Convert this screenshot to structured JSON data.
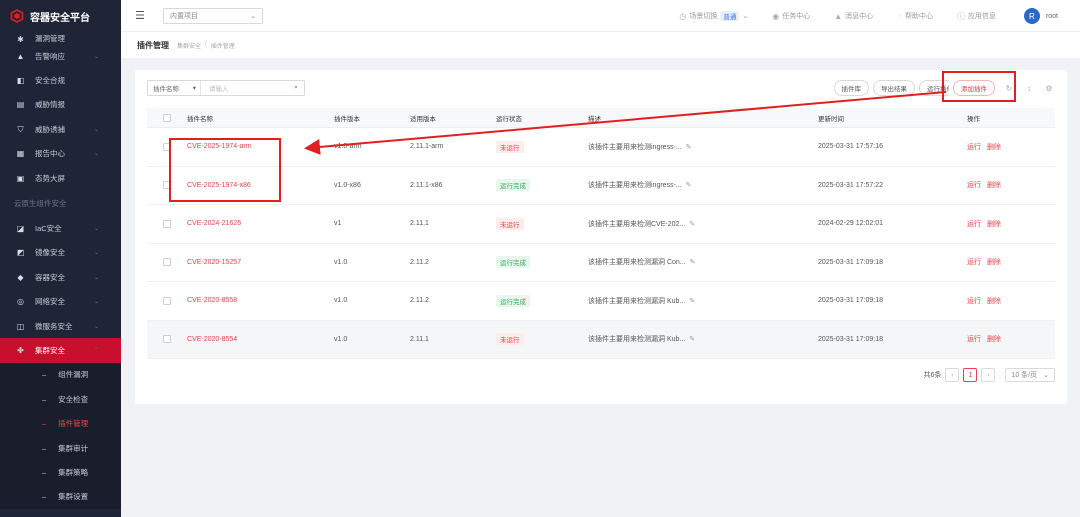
{
  "brand": {
    "title": "容器安全平台"
  },
  "sidebar": {
    "top_clipped": "漏洞管理",
    "items": [
      {
        "label": "告警响应",
        "icon": "bell-icon",
        "glyph": "▲",
        "chev": true
      },
      {
        "label": "安全合规",
        "icon": "clipboard-icon",
        "glyph": "◧",
        "chev": false
      },
      {
        "label": "威胁情报",
        "icon": "database-icon",
        "glyph": "▤",
        "chev": false
      },
      {
        "label": "威胁诱捕",
        "icon": "shield-icon",
        "glyph": "⛉",
        "chev": true
      },
      {
        "label": "报告中心",
        "icon": "report-icon",
        "glyph": "▦",
        "chev": true
      },
      {
        "label": "态势大屏",
        "icon": "screen-icon",
        "glyph": "▣",
        "chev": false
      }
    ],
    "group_title": "云原生组件安全",
    "group_items": [
      {
        "label": "IaC安全",
        "icon": "code-icon",
        "glyph": "◪",
        "chev": true
      },
      {
        "label": "镜像安全",
        "icon": "image-icon",
        "glyph": "◩",
        "chev": true
      },
      {
        "label": "容器安全",
        "icon": "container-icon",
        "glyph": "◆",
        "chev": true
      },
      {
        "label": "网络安全",
        "icon": "network-icon",
        "glyph": "◎",
        "chev": true
      },
      {
        "label": "微服务安全",
        "icon": "microservice-icon",
        "glyph": "◫",
        "chev": true
      },
      {
        "label": "集群安全",
        "icon": "cluster-icon",
        "glyph": "✤",
        "chev": true,
        "active": true
      }
    ],
    "sub_items": [
      {
        "label": "组件漏洞"
      },
      {
        "label": "安全检查"
      },
      {
        "label": "插件管理",
        "active": true
      },
      {
        "label": "集群审计"
      },
      {
        "label": "集群策略"
      },
      {
        "label": "集群设置"
      }
    ]
  },
  "topbar": {
    "project_select": "内置项目",
    "scene_label": "场景切换",
    "scene_badge": "普通",
    "task_center": "任务中心",
    "message_center": "消息中心",
    "help_center": "帮助中心",
    "app_info": "应用信息",
    "avatar_letter": "R",
    "user": "root"
  },
  "breadcrumb": {
    "page_title": "插件管理",
    "crumb_parent": "集群安全",
    "crumb_sep": "/",
    "crumb_current": "插件管理"
  },
  "filter": {
    "field": "插件名称",
    "placeholder": "请输入"
  },
  "toolbar": {
    "plugin_repo": "插件库",
    "export_results": "导出结果",
    "run_plugin": "运行插件",
    "add_plugin": "添加插件"
  },
  "table": {
    "headers": {
      "name": "插件名称",
      "version": "插件版本",
      "applicable": "适用版本",
      "state": "运行状态",
      "desc": "描述",
      "updated": "更新时间",
      "ops": "操作"
    },
    "rows": [
      {
        "name": "CVE-2025-1974-arm",
        "version": "v1.0-arm",
        "applicable": "2.11.1-arm",
        "state": "未运行",
        "state_kind": "red",
        "desc": "该插件主要用来检测ingress-...",
        "updated": "2025-03-31 17:57:16",
        "run": "运行",
        "delete": "删除"
      },
      {
        "name": "CVE-2025-1974-x86",
        "version": "v1.0-x86",
        "applicable": "2.11.1-x86",
        "state": "运行完成",
        "state_kind": "green",
        "desc": "该插件主要用来检测ingress-...",
        "updated": "2025-03-31 17:57:22",
        "run": "运行",
        "delete": "删除"
      },
      {
        "name": "CVE-2024-21626",
        "version": "v1",
        "applicable": "2.11.1",
        "state": "未运行",
        "state_kind": "red",
        "desc": "该插件主要用来检测CVE-202...",
        "updated": "2024-02-29 12:02:01",
        "run": "运行",
        "delete": "删除"
      },
      {
        "name": "CVE-2020-15257",
        "version": "v1.0",
        "applicable": "2.11.2",
        "state": "运行完成",
        "state_kind": "green",
        "desc": "该插件主要用来检测漏洞 Con...",
        "updated": "2025-03-31 17:09:18",
        "run": "运行",
        "delete": "删除"
      },
      {
        "name": "CVE-2020-8558",
        "version": "v1.0",
        "applicable": "2.11.2",
        "state": "运行完成",
        "state_kind": "green",
        "desc": "该插件主要用来检测漏洞 Kub...",
        "updated": "2025-03-31 17:09:18",
        "run": "运行",
        "delete": "删除"
      },
      {
        "name": "CVE-2020-8554",
        "version": "v1.0",
        "applicable": "2.11.1",
        "state": "未运行",
        "state_kind": "red",
        "desc": "该插件主要用来检测漏洞 Kub...",
        "updated": "2025-03-31 17:09:18",
        "run": "运行",
        "delete": "删除"
      }
    ]
  },
  "pagination": {
    "total": "共6条",
    "prev": "‹",
    "current": "1",
    "next": "›",
    "page_size": "10 条/页"
  },
  "colors": {
    "accent": "#c8102e",
    "sidebar_bg": "#1f2436",
    "annotation": "#e02020"
  }
}
